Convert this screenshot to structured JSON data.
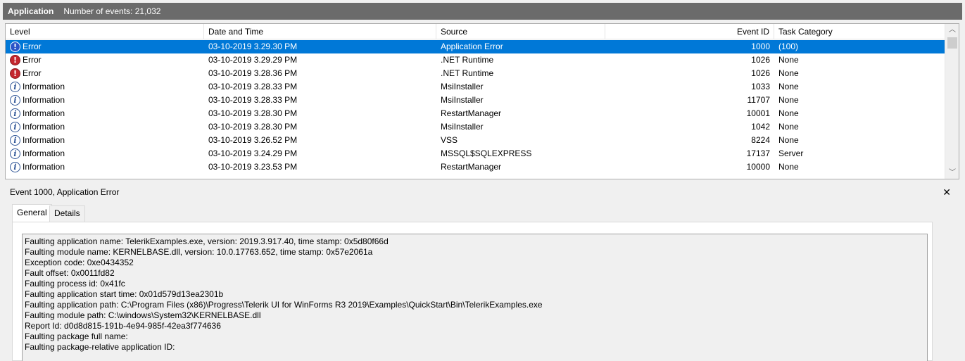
{
  "header": {
    "title": "Application",
    "event_count_label": "Number of events: 21,032"
  },
  "columns": [
    "Level",
    "Date and Time",
    "Source",
    "Event ID",
    "Task Category"
  ],
  "rows": [
    {
      "level": "Error",
      "date": "03-10-2019 3.29.30 PM",
      "source": "Application Error",
      "event_id": "1000",
      "task": "(100)",
      "selected": true
    },
    {
      "level": "Error",
      "date": "03-10-2019 3.29.29 PM",
      "source": ".NET Runtime",
      "event_id": "1026",
      "task": "None"
    },
    {
      "level": "Error",
      "date": "03-10-2019 3.28.36 PM",
      "source": ".NET Runtime",
      "event_id": "1026",
      "task": "None"
    },
    {
      "level": "Information",
      "date": "03-10-2019 3.28.33 PM",
      "source": "MsiInstaller",
      "event_id": "1033",
      "task": "None"
    },
    {
      "level": "Information",
      "date": "03-10-2019 3.28.33 PM",
      "source": "MsiInstaller",
      "event_id": "11707",
      "task": "None"
    },
    {
      "level": "Information",
      "date": "03-10-2019 3.28.30 PM",
      "source": "RestartManager",
      "event_id": "10001",
      "task": "None"
    },
    {
      "level": "Information",
      "date": "03-10-2019 3.28.30 PM",
      "source": "MsiInstaller",
      "event_id": "1042",
      "task": "None"
    },
    {
      "level": "Information",
      "date": "03-10-2019 3.26.52 PM",
      "source": "VSS",
      "event_id": "8224",
      "task": "None"
    },
    {
      "level": "Information",
      "date": "03-10-2019 3.24.29 PM",
      "source": "MSSQL$SQLEXPRESS",
      "event_id": "17137",
      "task": "Server"
    },
    {
      "level": "Information",
      "date": "03-10-2019 3.23.53 PM",
      "source": "RestartManager",
      "event_id": "10000",
      "task": "None"
    }
  ],
  "detail": {
    "title": "Event 1000, Application Error",
    "close_glyph": "✕",
    "tabs": [
      "General",
      "Details"
    ],
    "description_lines": [
      "Faulting application name: TelerikExamples.exe, version: 2019.3.917.40, time stamp: 0x5d80f66d",
      "Faulting module name: KERNELBASE.dll, version: 10.0.17763.652, time stamp: 0x57e2061a",
      "Exception code: 0xe0434352",
      "Fault offset: 0x0011fd82",
      "Faulting process id: 0x41fc",
      "Faulting application start time: 0x01d579d13ea2301b",
      "Faulting application path: C:\\Program Files (x86)\\Progress\\Telerik UI for WinForms R3 2019\\Examples\\QuickStart\\Bin\\TelerikExamples.exe",
      "Faulting module path: C:\\windows\\System32\\KERNELBASE.dll",
      "Report Id: d0d8d815-191b-4e94-985f-42ea3f774636",
      "Faulting package full name:",
      "Faulting package-relative application ID:"
    ]
  },
  "icons": {
    "error": "error-icon",
    "information": "information-icon",
    "error_glyph": "!",
    "info_glyph": "i"
  },
  "colors": {
    "selection": "#0078d7",
    "header_bar": "#6b6b6b",
    "error": "#c4262e"
  }
}
